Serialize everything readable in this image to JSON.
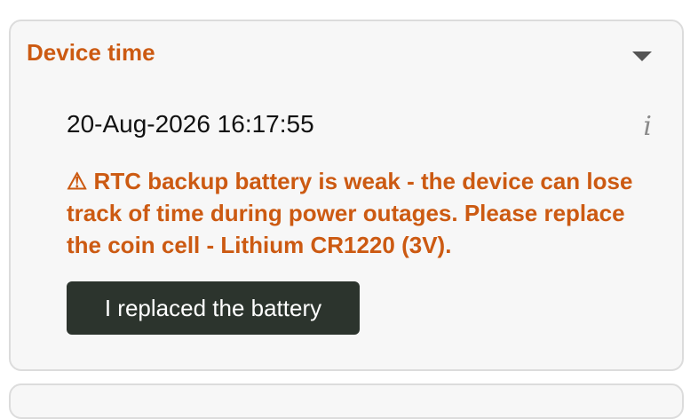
{
  "panel": {
    "title": "Device time",
    "expand_icon": "chevron-down-icon",
    "info_icon": "info-icon",
    "info_glyph": "i",
    "current_time": "20-Aug-2026 16:17:55",
    "warning_icon": "warning-triangle-icon",
    "warning_glyph": "⚠",
    "warning_text": "RTC backup battery is weak - the device can lose track of time during power outages. Please replace the coin cell - Lithium CR1220 (3V).",
    "button_label": "I replaced the battery"
  },
  "colors": {
    "accent": "#cc5a12",
    "button_bg": "#2c342d",
    "card_bg": "#f7f7f7",
    "card_border": "#dcdcdc"
  }
}
